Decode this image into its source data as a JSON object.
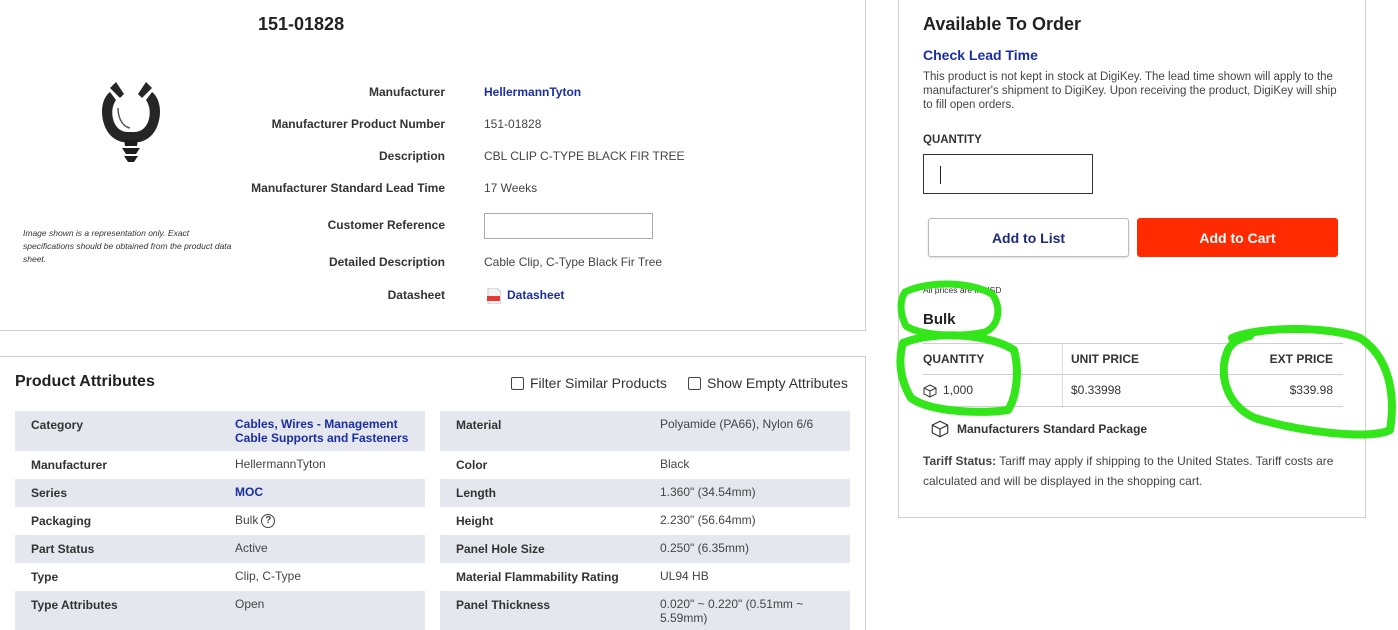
{
  "product": {
    "part_number": "151-01828",
    "image_note": "Image shown is a representation only. Exact specifications should be obtained from the product data sheet.",
    "details": [
      {
        "label": "Manufacturer",
        "value": "HellermannTyton",
        "link": true
      },
      {
        "label": "Manufacturer Product Number",
        "value": "151-01828"
      },
      {
        "label": "Description",
        "value": "CBL CLIP C-TYPE BLACK FIR TREE"
      },
      {
        "label": "Manufacturer Standard Lead Time",
        "value": "17 Weeks"
      },
      {
        "label": "Customer Reference",
        "value": ""
      },
      {
        "label": "Detailed Description",
        "value": "Cable Clip, C-Type Black Fir Tree"
      },
      {
        "label": "Datasheet",
        "value": "Datasheet",
        "link": true,
        "icon": "pdf-icon"
      }
    ]
  },
  "attributes": {
    "heading": "Product Attributes",
    "filter_similar": "Filter Similar Products",
    "show_empty": "Show Empty Attributes",
    "left": [
      {
        "name": "Category",
        "value": "Cables, Wires - Management\nCable Supports and Fasteners",
        "link": true
      },
      {
        "name": "Manufacturer",
        "value": "HellermannTyton"
      },
      {
        "name": "Series",
        "value": "MOC",
        "link": true
      },
      {
        "name": "Packaging",
        "value": "Bulk",
        "help": "?"
      },
      {
        "name": "Part Status",
        "value": "Active"
      },
      {
        "name": "Type",
        "value": "Clip, C-Type"
      },
      {
        "name": "Type Attributes",
        "value": "Open"
      }
    ],
    "right": [
      {
        "name": "Material",
        "value": "Polyamide (PA66), Nylon 6/6"
      },
      {
        "name": "Color",
        "value": "Black"
      },
      {
        "name": "Length",
        "value": "1.360\" (34.54mm)"
      },
      {
        "name": "Height",
        "value": "2.230\" (56.64mm)"
      },
      {
        "name": "Panel Hole Size",
        "value": "0.250\" (6.35mm)"
      },
      {
        "name": "Material Flammability Rating",
        "value": "UL94 HB"
      },
      {
        "name": "Panel Thickness",
        "value": "0.020\" ~ 0.220\" (0.51mm ~\n5.59mm)"
      }
    ]
  },
  "order": {
    "title": "Available To Order",
    "lead_time_link": "Check Lead Time",
    "lead_note": "This product is not kept in stock at DigiKey. The lead time shown will apply to the manufacturer's shipment to DigiKey. Upon receiving the product, DigiKey will ship to fill open orders.",
    "quantity_label": "QUANTITY",
    "quantity_value": "",
    "add_to_list": "Add to List",
    "add_to_cart": "Add to Cart",
    "usd_note": "All prices are in USD",
    "packaging": "Bulk",
    "price_headers": {
      "quantity": "QUANTITY",
      "unit": "UNIT PRICE",
      "ext": "EXT PRICE"
    },
    "price_rows": [
      {
        "quantity": "1,000",
        "unit": "$0.33998",
        "ext": "$339.98"
      }
    ],
    "std_package": "Manufacturers Standard Package",
    "tariff_label": "Tariff Status:",
    "tariff_text": " Tariff may apply if shipping to the United States. Tariff costs are calculated and will be displayed in the shopping cart."
  },
  "colors": {
    "link": "#1a2ea0",
    "cart_button": "#ff2a00",
    "annotation": "#33e61a",
    "row_shade": "#e4e7ee"
  }
}
